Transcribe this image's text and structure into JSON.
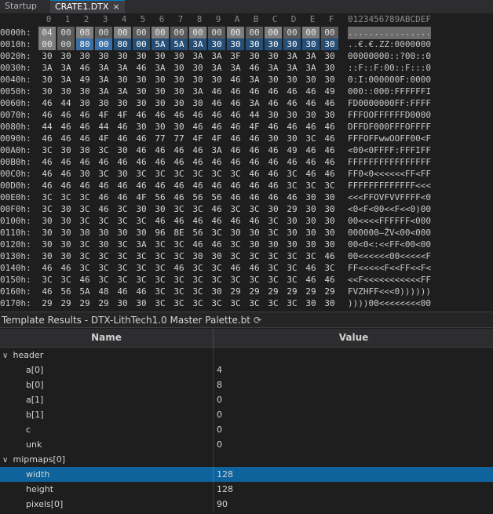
{
  "tabs": [
    {
      "label": "Startup",
      "active": false
    },
    {
      "label": "CRATE1.DTX",
      "active": true,
      "close": "×"
    }
  ],
  "hex": {
    "columns": [
      "0",
      "1",
      "2",
      "3",
      "4",
      "5",
      "6",
      "7",
      "8",
      "9",
      "A",
      "B",
      "C",
      "D",
      "E",
      "F"
    ],
    "ascii_header": "0123456789ABCDEF",
    "rows": [
      {
        "addr": "0000h:",
        "bytes": [
          "04",
          "00",
          "08",
          "00",
          "00",
          "00",
          "00",
          "00",
          "00",
          "00",
          "00",
          "00",
          "00",
          "00",
          "00",
          "00"
        ],
        "ascii": "................"
      },
      {
        "addr": "0010h:",
        "bytes": [
          "00",
          "00",
          "80",
          "00",
          "80",
          "00",
          "5A",
          "5A",
          "3A",
          "30",
          "30",
          "30",
          "30",
          "30",
          "30",
          "30"
        ],
        "ascii": "..€.€.ZZ:0000000"
      },
      {
        "addr": "0020h:",
        "bytes": [
          "30",
          "30",
          "30",
          "30",
          "30",
          "30",
          "30",
          "30",
          "3A",
          "3A",
          "3F",
          "30",
          "30",
          "3A",
          "3A",
          "30"
        ],
        "ascii": "00000000::?00::0"
      },
      {
        "addr": "0030h:",
        "bytes": [
          "3A",
          "3A",
          "46",
          "3A",
          "3A",
          "46",
          "3A",
          "30",
          "30",
          "3A",
          "3A",
          "46",
          "3A",
          "3A",
          "3A",
          "30"
        ],
        "ascii": "::F::F:00::F:::0"
      },
      {
        "addr": "0040h:",
        "bytes": [
          "30",
          "3A",
          "49",
          "3A",
          "30",
          "30",
          "30",
          "30",
          "30",
          "30",
          "46",
          "3A",
          "30",
          "30",
          "30",
          "30"
        ],
        "ascii": "0:I:000000F:0000"
      },
      {
        "addr": "0050h:",
        "bytes": [
          "30",
          "30",
          "30",
          "3A",
          "3A",
          "30",
          "30",
          "30",
          "3A",
          "46",
          "46",
          "46",
          "46",
          "46",
          "46",
          "49"
        ],
        "ascii": "000::000:FFFFFFI"
      },
      {
        "addr": "0060h:",
        "bytes": [
          "46",
          "44",
          "30",
          "30",
          "30",
          "30",
          "30",
          "30",
          "30",
          "46",
          "46",
          "3A",
          "46",
          "46",
          "46",
          "46"
        ],
        "ascii": "FD0000000FF:FFFF"
      },
      {
        "addr": "0070h:",
        "bytes": [
          "46",
          "46",
          "46",
          "4F",
          "4F",
          "46",
          "46",
          "46",
          "46",
          "46",
          "46",
          "44",
          "30",
          "30",
          "30",
          "30"
        ],
        "ascii": "FFFOOFFFFFFD0000"
      },
      {
        "addr": "0080h:",
        "bytes": [
          "44",
          "46",
          "46",
          "44",
          "46",
          "30",
          "30",
          "30",
          "46",
          "46",
          "46",
          "4F",
          "46",
          "46",
          "46",
          "46"
        ],
        "ascii": "DFFDF000FFFOFFFF"
      },
      {
        "addr": "0090h:",
        "bytes": [
          "46",
          "46",
          "46",
          "4F",
          "46",
          "46",
          "77",
          "77",
          "4F",
          "4F",
          "46",
          "46",
          "30",
          "30",
          "3C",
          "46"
        ],
        "ascii": "FFFOFFwwOOFF00<F"
      },
      {
        "addr": "00A0h:",
        "bytes": [
          "3C",
          "30",
          "30",
          "3C",
          "30",
          "46",
          "46",
          "46",
          "46",
          "3A",
          "46",
          "46",
          "46",
          "49",
          "46",
          "46"
        ],
        "ascii": "<00<0FFFF:FFFIFF"
      },
      {
        "addr": "00B0h:",
        "bytes": [
          "46",
          "46",
          "46",
          "46",
          "46",
          "46",
          "46",
          "46",
          "46",
          "46",
          "46",
          "46",
          "46",
          "46",
          "46",
          "46"
        ],
        "ascii": "FFFFFFFFFFFFFFFF"
      },
      {
        "addr": "00C0h:",
        "bytes": [
          "46",
          "46",
          "30",
          "3C",
          "30",
          "3C",
          "3C",
          "3C",
          "3C",
          "3C",
          "3C",
          "46",
          "46",
          "3C",
          "46",
          "46"
        ],
        "ascii": "FF0<0<<<<<<FF<FF"
      },
      {
        "addr": "00D0h:",
        "bytes": [
          "46",
          "46",
          "46",
          "46",
          "46",
          "46",
          "46",
          "46",
          "46",
          "46",
          "46",
          "46",
          "46",
          "3C",
          "3C",
          "3C"
        ],
        "ascii": "FFFFFFFFFFFFF<<<"
      },
      {
        "addr": "00E0h:",
        "bytes": [
          "3C",
          "3C",
          "3C",
          "46",
          "46",
          "4F",
          "56",
          "46",
          "56",
          "56",
          "46",
          "46",
          "46",
          "46",
          "30",
          "30"
        ],
        "ascii": "<<<FFOVFVVFFFF<0"
      },
      {
        "addr": "00F0h:",
        "bytes": [
          "3C",
          "30",
          "3C",
          "46",
          "3C",
          "30",
          "30",
          "3C",
          "3C",
          "46",
          "3C",
          "3C",
          "30",
          "29",
          "30",
          "30"
        ],
        "ascii": "<0<F<00<<F<<0)00"
      },
      {
        "addr": "0100h:",
        "bytes": [
          "30",
          "30",
          "3C",
          "3C",
          "3C",
          "3C",
          "46",
          "46",
          "46",
          "46",
          "46",
          "46",
          "3C",
          "30",
          "30",
          "30"
        ],
        "ascii": "00<<<<FFFFFF<000"
      },
      {
        "addr": "0110h:",
        "bytes": [
          "30",
          "30",
          "30",
          "30",
          "30",
          "30",
          "96",
          "8E",
          "56",
          "3C",
          "30",
          "30",
          "3C",
          "30",
          "30",
          "30"
        ],
        "ascii": "000000–ŽV<00<000"
      },
      {
        "addr": "0120h:",
        "bytes": [
          "30",
          "30",
          "3C",
          "30",
          "3C",
          "3A",
          "3C",
          "3C",
          "46",
          "46",
          "3C",
          "30",
          "30",
          "30",
          "30",
          "30"
        ],
        "ascii": "00<0<:<<FF<00<00"
      },
      {
        "addr": "0130h:",
        "bytes": [
          "30",
          "30",
          "3C",
          "3C",
          "3C",
          "3C",
          "3C",
          "3C",
          "30",
          "30",
          "3C",
          "3C",
          "3C",
          "3C",
          "3C",
          "46"
        ],
        "ascii": "00<<<<<<00<<<<<F"
      },
      {
        "addr": "0140h:",
        "bytes": [
          "46",
          "46",
          "3C",
          "3C",
          "3C",
          "3C",
          "3C",
          "46",
          "3C",
          "3C",
          "46",
          "46",
          "3C",
          "3C",
          "46",
          "3C"
        ],
        "ascii": "FF<<<<<F<<FF<<F<"
      },
      {
        "addr": "0150h:",
        "bytes": [
          "3C",
          "3C",
          "46",
          "3C",
          "3C",
          "3C",
          "3C",
          "3C",
          "3C",
          "3C",
          "3C",
          "3C",
          "3C",
          "3C",
          "46",
          "46"
        ],
        "ascii": "<<F<<<<<<<<<<<FF"
      },
      {
        "addr": "0160h:",
        "bytes": [
          "46",
          "56",
          "5A",
          "48",
          "46",
          "46",
          "3C",
          "3C",
          "3C",
          "30",
          "29",
          "29",
          "29",
          "29",
          "29",
          "29"
        ],
        "ascii": "FVZHFF<<<0))))))"
      },
      {
        "addr": "0170h:",
        "bytes": [
          "29",
          "29",
          "29",
          "29",
          "30",
          "30",
          "3C",
          "3C",
          "3C",
          "3C",
          "3C",
          "3C",
          "3C",
          "3C",
          "30",
          "30"
        ],
        "ascii": "))))00<<<<<<<<00"
      }
    ]
  },
  "template": {
    "title": "Template Results - DTX-LithTech1.0 Master Palette.bt",
    "refresh_icon": "⟳",
    "columns": {
      "name": "Name",
      "value": "Value"
    },
    "rows": [
      {
        "name": "header",
        "value": "",
        "indent": 0,
        "expander": "∨"
      },
      {
        "name": "a[0]",
        "value": "4",
        "indent": 1
      },
      {
        "name": "b[0]",
        "value": "8",
        "indent": 1
      },
      {
        "name": "a[1]",
        "value": "0",
        "indent": 1
      },
      {
        "name": "b[1]",
        "value": "0",
        "indent": 1
      },
      {
        "name": "c",
        "value": "0",
        "indent": 1
      },
      {
        "name": "unk",
        "value": "0",
        "indent": 1
      },
      {
        "name": "mipmaps[0]",
        "value": "",
        "indent": 0,
        "expander": "∨"
      },
      {
        "name": "width",
        "value": "128",
        "indent": 1,
        "selected": true
      },
      {
        "name": "height",
        "value": "128",
        "indent": 1
      },
      {
        "name": "pixels[0]",
        "value": "90",
        "indent": 1
      }
    ]
  },
  "colors": {
    "accent": "#007acc",
    "selection": "#0e639c",
    "background": "#1e1e1e"
  }
}
